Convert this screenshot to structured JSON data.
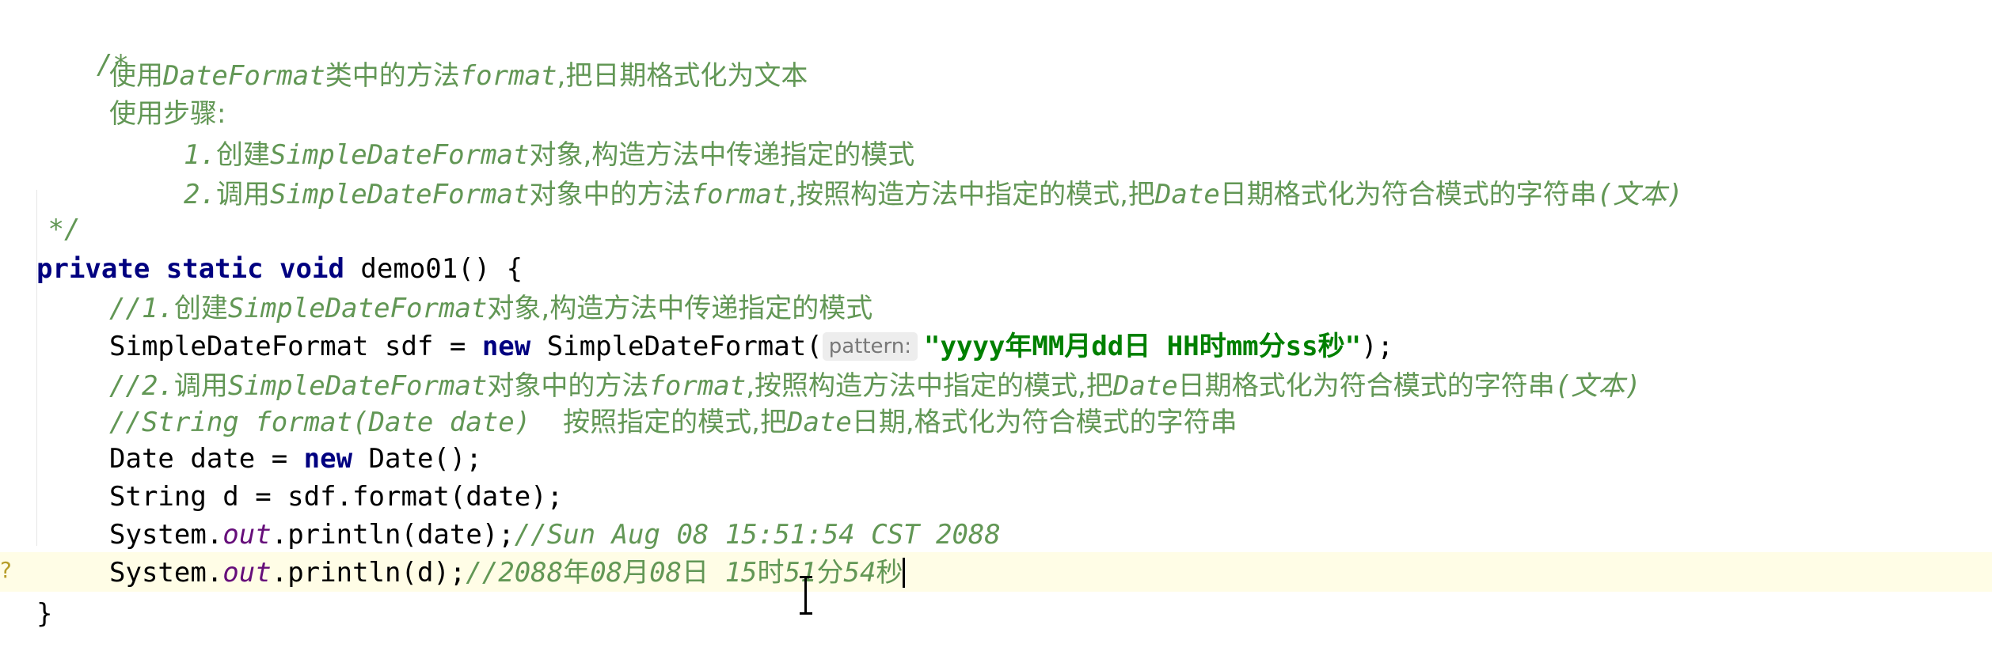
{
  "colors": {
    "comment": "#629755",
    "keyword": "#000080",
    "string": "#008000",
    "static_field": "#660e7a",
    "caret_row": "#fffde6",
    "hint_bg": "#ededed"
  },
  "icons": {
    "gutter": "intention-bulb-icon",
    "cursor": "text-cursor-icon"
  },
  "doc": {
    "open": "/*",
    "line1": {
      "a": "使用",
      "b": "DateFormat",
      "c": "类中的方法",
      "d": "format",
      "e": ",把日期格式化为文本"
    },
    "line2": "使用步骤:",
    "step1": {
      "a": "1.",
      "b": "创建",
      "c": "SimpleDateFormat",
      "d": "对象,构造方法中传递指定的模式"
    },
    "step2": {
      "a": "2.",
      "b": "调用",
      "c": "SimpleDateFormat",
      "d": "对象中的方法",
      "e": "format",
      "f": ",按照构造方法中指定的模式,把",
      "g": "Date",
      "h": "日期格式化为符合模式的字符串",
      "i": "(文本)"
    },
    "close": " */"
  },
  "code": {
    "sig": {
      "kw": "private static void",
      "rest": " demo01() {"
    },
    "c1": {
      "a": "//1.",
      "b": "创建",
      "c": "SimpleDateFormat",
      "d": "对象,构造方法中传递指定的模式"
    },
    "sdf": {
      "a": "SimpleDateFormat sdf = ",
      "kw": "new",
      "b": " SimpleDateFormat(",
      "hint": "pattern:",
      "str1": "\"yyyy",
      "s_year": "年",
      "str2": "MM",
      "s_month": "月",
      "str3": "dd",
      "s_day": "日",
      "str4": " HH",
      "s_hour": "时",
      "str5": "mm",
      "s_min": "分",
      "str6": "ss",
      "s_sec": "秒",
      "str7": "\"",
      "end": ");"
    },
    "c2": {
      "a": "//2.",
      "b": "调用",
      "c": "SimpleDateFormat",
      "d": "对象中的方法",
      "e": "format",
      "f": ",按照构造方法中指定的模式,把",
      "g": "Date",
      "h": "日期格式化为符合模式的字符串",
      "i": "(文本)"
    },
    "c3": {
      "a": "//String format(Date date)  ",
      "b": "按照指定的模式,把",
      "c": "Date",
      "d": "日期,格式化为符合模式的字符串"
    },
    "date": {
      "a": "Date date = ",
      "kw": "new",
      "b": " Date();"
    },
    "fmt": "String d = sdf.format(date);",
    "p1": {
      "a": "System.",
      "fld": "out",
      "b": ".println(date);",
      "cm": "//Sun Aug 08 15:51:54 CST 2088"
    },
    "p2": {
      "a": "System.",
      "fld": "out",
      "b": ".println(d);",
      "cm1": "//2088",
      "y": "年",
      "cm2": "08",
      "m": "月",
      "cm3": "08",
      "d": "日",
      "cm4": " 15",
      "h": "时",
      "cm5": "51",
      "mi": "分",
      "cm6": "54",
      "s": "秒"
    },
    "close": "}"
  }
}
